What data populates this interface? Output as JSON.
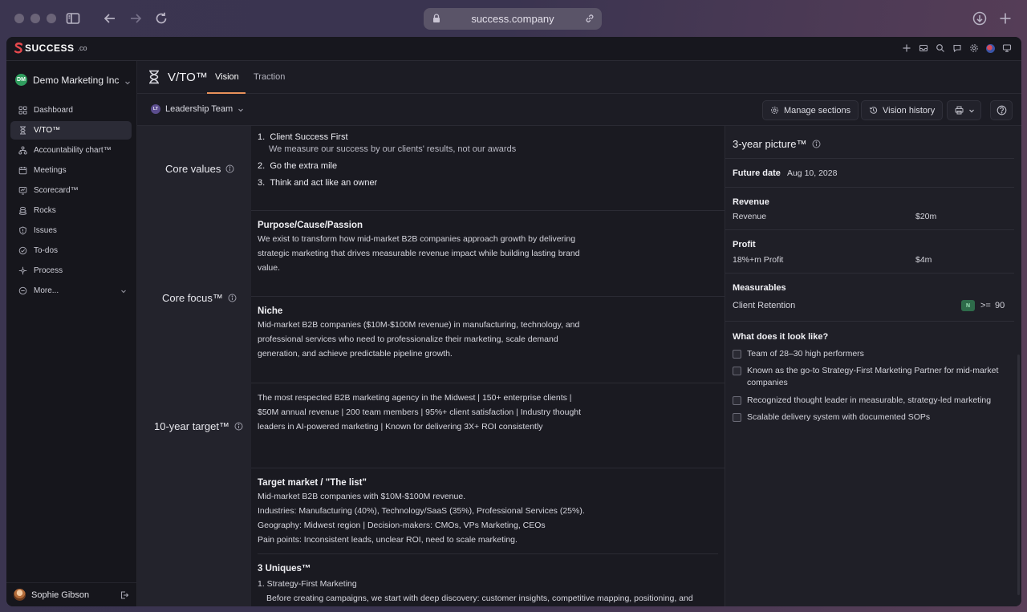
{
  "browser": {
    "url": "success.company"
  },
  "app": {
    "logo_text": "SUCCESS",
    "logo_suffix": ".co"
  },
  "sidebar": {
    "org_initials": "DM",
    "org_name": "Demo Marketing Inc",
    "items": [
      {
        "label": "Dashboard",
        "icon": "grid-icon"
      },
      {
        "label": "V/TO™",
        "icon": "hourglass-icon"
      },
      {
        "label": "Accountability chart™",
        "icon": "org-chart-icon"
      },
      {
        "label": "Meetings",
        "icon": "calendar-icon"
      },
      {
        "label": "Scorecard™",
        "icon": "scorecard-icon"
      },
      {
        "label": "Rocks",
        "icon": "rocks-icon"
      },
      {
        "label": "Issues",
        "icon": "shield-icon"
      },
      {
        "label": "To-dos",
        "icon": "todo-icon"
      },
      {
        "label": "Process",
        "icon": "process-icon"
      },
      {
        "label": "More...",
        "icon": "more-icon"
      }
    ],
    "active_index": 1,
    "user_name": "Sophie Gibson"
  },
  "header": {
    "title": "V/TO™",
    "tabs": [
      {
        "label": "Vision"
      },
      {
        "label": "Traction"
      }
    ],
    "active_tab": "Vision"
  },
  "toolbar": {
    "team_initials": "LT",
    "team_name": "Leadership Team",
    "manage_label": "Manage sections",
    "history_label": "Vision history"
  },
  "vision": {
    "core_values": {
      "label": "Core values",
      "items": [
        {
          "num": "1.",
          "title": "Client Success First",
          "sub": "We measure our success by our clients' results, not our awards"
        },
        {
          "num": "2.",
          "title": "Go the extra mile",
          "sub": ""
        },
        {
          "num": "3.",
          "title": "Think and act like an owner",
          "sub": ""
        }
      ]
    },
    "core_focus": {
      "label": "Core focus™",
      "purpose_title": "Purpose/Cause/Passion",
      "purpose_lines": [
        "We exist to transform how mid-market B2B companies approach growth by delivering",
        "strategic marketing that drives measurable revenue impact while building lasting brand",
        "value."
      ],
      "niche_title": "Niche",
      "niche_lines": [
        "Mid-market B2B companies ($10M-$100M revenue) in manufacturing, technology, and",
        "professional services who need to professionalize their marketing, scale demand",
        "generation, and achieve predictable pipeline growth."
      ]
    },
    "ten_year": {
      "label": "10-year target™",
      "lines": [
        "The most respected B2B marketing agency in the Midwest | 150+ enterprise clients |",
        "$50M annual revenue | 200 team members | 95%+ client satisfaction | Industry thought",
        "leaders in AI-powered marketing | Known for delivering 3X+ ROI consistently"
      ]
    },
    "marketing": {
      "target_title": "Target market / \"The list\"",
      "target_lines": [
        "Mid-market B2B companies with $10M-$100M revenue.",
        "Industries: Manufacturing (40%), Technology/SaaS (35%), Professional Services (25%).",
        "Geography: Midwest region | Decision-makers: CMOs, VPs Marketing, CEOs",
        "Pain points: Inconsistent leads, unclear ROI, need to scale marketing."
      ],
      "uniques_title": "3 Uniques™",
      "uniques_first": "1. Strategy-First Marketing",
      "uniques_first_sub": "Before creating campaigns, we start with deep discovery: customer insights, competitive mapping, positioning, and"
    }
  },
  "picture": {
    "title": "3-year picture™",
    "future_date_label": "Future date",
    "future_date": "Aug 10, 2028",
    "revenue_label": "Revenue",
    "revenue_row": "Revenue",
    "revenue_value": "$20m",
    "profit_label": "Profit",
    "profit_row": "18%+m Profit",
    "profit_value": "$4m",
    "measurables_label": "Measurables",
    "measurable_name": "Client Retention",
    "measurable_badge": "N",
    "measurable_op": ">=",
    "measurable_value": "90",
    "look_like_label": "What does it look like?",
    "look_like_items": [
      "Team of 28–30 high performers",
      "Known as the go-to Strategy-First Marketing Partner for mid-market companies",
      "Recognized thought leader in measurable, strategy-led marketing",
      "Scalable delivery system with documented SOPs"
    ]
  }
}
